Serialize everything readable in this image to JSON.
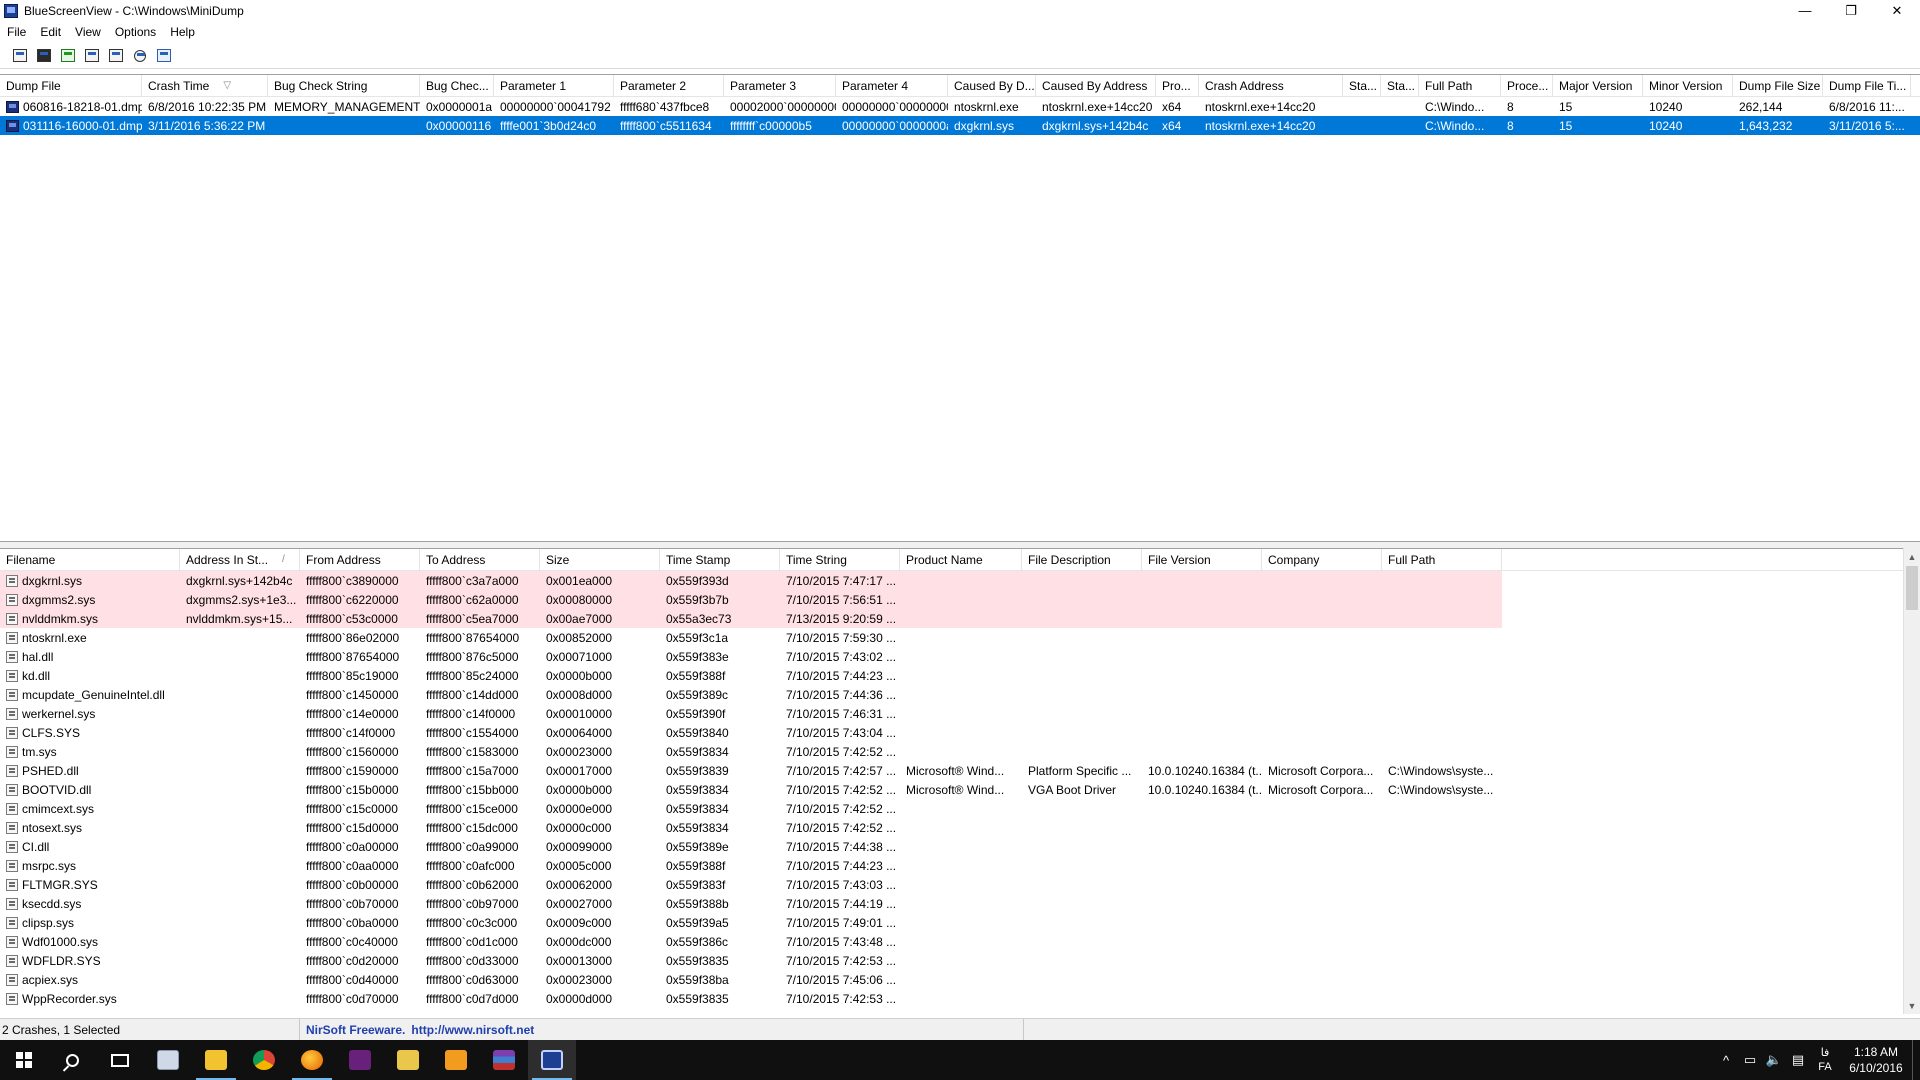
{
  "window": {
    "title": "BlueScreenView  -  C:\\Windows\\MiniDump",
    "minimize": "—",
    "maximize": "❐",
    "close": "✕"
  },
  "menu": [
    "File",
    "Edit",
    "View",
    "Options",
    "Help"
  ],
  "toolbar": [
    "properties-icon",
    "save-icon",
    "refresh-icon",
    "copy-icon",
    "html-report-icon",
    "find-icon",
    "exit-icon"
  ],
  "crashes": {
    "columns": [
      "Dump File",
      "Crash Time",
      "Bug Check String",
      "Bug Chec...",
      "Parameter 1",
      "Parameter 2",
      "Parameter 3",
      "Parameter 4",
      "Caused By D...",
      "Caused By Address",
      "Pro...",
      "Crash Address",
      "Sta...",
      "Sta...",
      "Full Path",
      "Proce...",
      "Major Version",
      "Minor Version",
      "Dump File Size",
      "Dump File Ti..."
    ],
    "sort_indicator": "▽",
    "rows": [
      [
        "060816-18218-01.dmp",
        "6/8/2016 10:22:35 PM",
        "MEMORY_MANAGEMENT",
        "0x0000001a",
        "00000000`00041792",
        "fffff680`437fbce8",
        "00002000`00000000",
        "00000000`00000000",
        "ntoskrnl.exe",
        "ntoskrnl.exe+14cc20",
        "x64",
        "ntoskrnl.exe+14cc20",
        "",
        "",
        "C:\\Windo...",
        "8",
        "15",
        "10240",
        "262,144",
        "6/8/2016 11:..."
      ],
      [
        "031116-16000-01.dmp",
        "3/11/2016 5:36:22 PM",
        "",
        "0x00000116",
        "ffffe001`3b0d24c0",
        "fffff800`c5511634",
        "ffffffff`c00000b5",
        "00000000`0000000a",
        "dxgkrnl.sys",
        "dxgkrnl.sys+142b4c",
        "x64",
        "ntoskrnl.exe+14cc20",
        "",
        "",
        "C:\\Windo...",
        "8",
        "15",
        "10240",
        "1,643,232",
        "3/11/2016 5:..."
      ]
    ],
    "selected_row": 1
  },
  "modules": {
    "columns": [
      "Filename",
      "Address In St...",
      "From Address",
      "To Address",
      "Size",
      "Time Stamp",
      "Time String",
      "Product Name",
      "File Description",
      "File Version",
      "Company",
      "Full Path"
    ],
    "sort_indicator": "/",
    "rows": [
      [
        "dxgkrnl.sys",
        "dxgkrnl.sys+142b4c",
        "fffff800`c3890000",
        "fffff800`c3a7a000",
        "0x001ea000",
        "0x559f393d",
        "7/10/2015 7:47:17 ...",
        "",
        "",
        "",
        "",
        ""
      ],
      [
        "dxgmms2.sys",
        "dxgmms2.sys+1e3...",
        "fffff800`c6220000",
        "fffff800`c62a0000",
        "0x00080000",
        "0x559f3b7b",
        "7/10/2015 7:56:51 ...",
        "",
        "",
        "",
        "",
        ""
      ],
      [
        "nvlddmkm.sys",
        "nvlddmkm.sys+15...",
        "fffff800`c53c0000",
        "fffff800`c5ea7000",
        "0x00ae7000",
        "0x55a3ec73",
        "7/13/2015 9:20:59 ...",
        "",
        "",
        "",
        "",
        ""
      ],
      [
        "ntoskrnl.exe",
        "",
        "fffff800`86e02000",
        "fffff800`87654000",
        "0x00852000",
        "0x559f3c1a",
        "7/10/2015 7:59:30 ...",
        "",
        "",
        "",
        "",
        ""
      ],
      [
        "hal.dll",
        "",
        "fffff800`87654000",
        "fffff800`876c5000",
        "0x00071000",
        "0x559f383e",
        "7/10/2015 7:43:02 ...",
        "",
        "",
        "",
        "",
        ""
      ],
      [
        "kd.dll",
        "",
        "fffff800`85c19000",
        "fffff800`85c24000",
        "0x0000b000",
        "0x559f388f",
        "7/10/2015 7:44:23 ...",
        "",
        "",
        "",
        "",
        ""
      ],
      [
        "mcupdate_GenuineIntel.dll",
        "",
        "fffff800`c1450000",
        "fffff800`c14dd000",
        "0x0008d000",
        "0x559f389c",
        "7/10/2015 7:44:36 ...",
        "",
        "",
        "",
        "",
        ""
      ],
      [
        "werkernel.sys",
        "",
        "fffff800`c14e0000",
        "fffff800`c14f0000",
        "0x00010000",
        "0x559f390f",
        "7/10/2015 7:46:31 ...",
        "",
        "",
        "",
        "",
        ""
      ],
      [
        "CLFS.SYS",
        "",
        "fffff800`c14f0000",
        "fffff800`c1554000",
        "0x00064000",
        "0x559f3840",
        "7/10/2015 7:43:04 ...",
        "",
        "",
        "",
        "",
        ""
      ],
      [
        "tm.sys",
        "",
        "fffff800`c1560000",
        "fffff800`c1583000",
        "0x00023000",
        "0x559f3834",
        "7/10/2015 7:42:52 ...",
        "",
        "",
        "",
        "",
        ""
      ],
      [
        "PSHED.dll",
        "",
        "fffff800`c1590000",
        "fffff800`c15a7000",
        "0x00017000",
        "0x559f3839",
        "7/10/2015 7:42:57 ...",
        "Microsoft® Wind...",
        "Platform Specific ...",
        "10.0.10240.16384 (t...",
        "Microsoft Corpora...",
        "C:\\Windows\\syste..."
      ],
      [
        "BOOTVID.dll",
        "",
        "fffff800`c15b0000",
        "fffff800`c15bb000",
        "0x0000b000",
        "0x559f3834",
        "7/10/2015 7:42:52 ...",
        "Microsoft® Wind...",
        "VGA Boot Driver",
        "10.0.10240.16384 (t...",
        "Microsoft Corpora...",
        "C:\\Windows\\syste..."
      ],
      [
        "cmimcext.sys",
        "",
        "fffff800`c15c0000",
        "fffff800`c15ce000",
        "0x0000e000",
        "0x559f3834",
        "7/10/2015 7:42:52 ...",
        "",
        "",
        "",
        "",
        ""
      ],
      [
        "ntosext.sys",
        "",
        "fffff800`c15d0000",
        "fffff800`c15dc000",
        "0x0000c000",
        "0x559f3834",
        "7/10/2015 7:42:52 ...",
        "",
        "",
        "",
        "",
        ""
      ],
      [
        "CI.dll",
        "",
        "fffff800`c0a00000",
        "fffff800`c0a99000",
        "0x00099000",
        "0x559f389e",
        "7/10/2015 7:44:38 ...",
        "",
        "",
        "",
        "",
        ""
      ],
      [
        "msrpc.sys",
        "",
        "fffff800`c0aa0000",
        "fffff800`c0afc000",
        "0x0005c000",
        "0x559f388f",
        "7/10/2015 7:44:23 ...",
        "",
        "",
        "",
        "",
        ""
      ],
      [
        "FLTMGR.SYS",
        "",
        "fffff800`c0b00000",
        "fffff800`c0b62000",
        "0x00062000",
        "0x559f383f",
        "7/10/2015 7:43:03 ...",
        "",
        "",
        "",
        "",
        ""
      ],
      [
        "ksecdd.sys",
        "",
        "fffff800`c0b70000",
        "fffff800`c0b97000",
        "0x00027000",
        "0x559f388b",
        "7/10/2015 7:44:19 ...",
        "",
        "",
        "",
        "",
        ""
      ],
      [
        "clipsp.sys",
        "",
        "fffff800`c0ba0000",
        "fffff800`c0c3c000",
        "0x0009c000",
        "0x559f39a5",
        "7/10/2015 7:49:01 ...",
        "",
        "",
        "",
        "",
        ""
      ],
      [
        "Wdf01000.sys",
        "",
        "fffff800`c0c40000",
        "fffff800`c0d1c000",
        "0x000dc000",
        "0x559f386c",
        "7/10/2015 7:43:48 ...",
        "",
        "",
        "",
        "",
        ""
      ],
      [
        "WDFLDR.SYS",
        "",
        "fffff800`c0d20000",
        "fffff800`c0d33000",
        "0x00013000",
        "0x559f3835",
        "7/10/2015 7:42:53 ...",
        "",
        "",
        "",
        "",
        ""
      ],
      [
        "acpiex.sys",
        "",
        "fffff800`c0d40000",
        "fffff800`c0d63000",
        "0x00023000",
        "0x559f38ba",
        "7/10/2015 7:45:06 ...",
        "",
        "",
        "",
        "",
        ""
      ],
      [
        "WppRecorder.sys",
        "",
        "fffff800`c0d70000",
        "fffff800`c0d7d000",
        "0x0000d000",
        "0x559f3835",
        "7/10/2015 7:42:53 ...",
        "",
        "",
        "",
        "",
        ""
      ]
    ],
    "highlighted_rows": [
      0,
      1,
      2
    ],
    "highlight_color": "#ffe0e4"
  },
  "statusbar": {
    "count": "2 Crashes, 1 Selected",
    "freeware": "NirSoft Freeware.",
    "url": "http://www.nirsoft.net"
  },
  "taskbar": {
    "apps": [
      "start-icon",
      "search-icon",
      "task-view-icon",
      "notepad-icon",
      "file-explorer-icon",
      "chrome-icon",
      "firefox-icon",
      "visual-studio-icon",
      "folder-icon",
      "sublime-icon",
      "winrar-icon",
      "bluescreenview-icon"
    ],
    "tray": {
      "chevron": "^",
      "network": "▭",
      "volume": "🔈",
      "message": "▤",
      "lang_top": "فا",
      "lang_bottom": "FA",
      "time": "1:18 AM",
      "date": "6/10/2016"
    }
  },
  "colors": {
    "selection": "#0078d7",
    "link": "#1f3fae",
    "taskbar": "#101010"
  }
}
